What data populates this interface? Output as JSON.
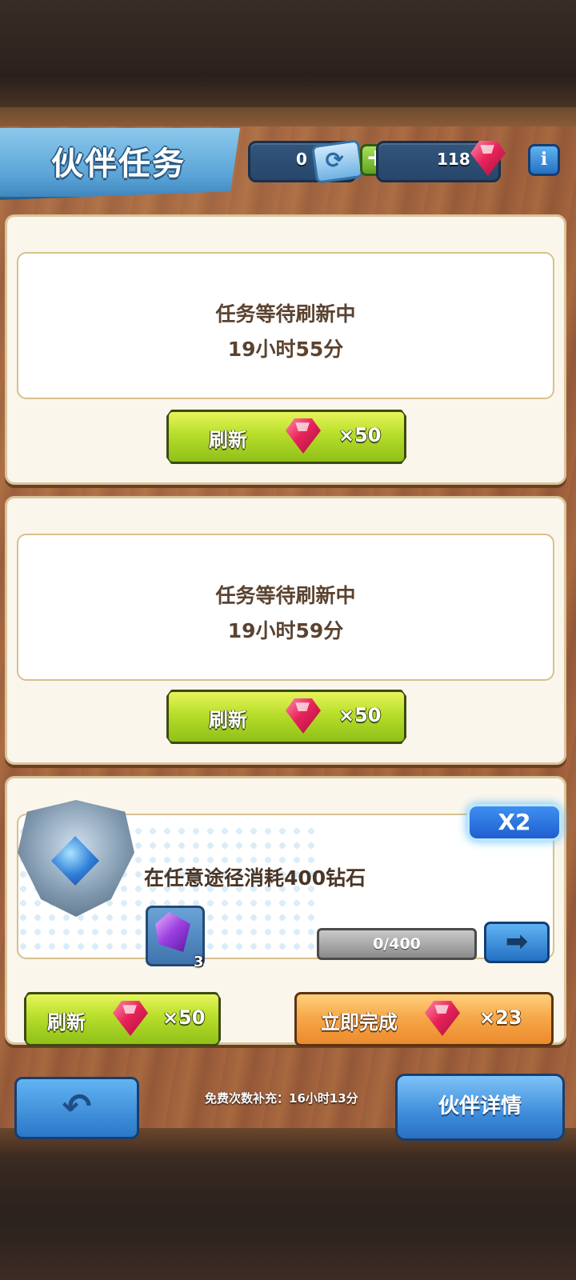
{
  "header": {
    "title": "伙伴任务",
    "ticket_count": "0",
    "gem_count": "118",
    "info_label": "i",
    "plus_label": "+"
  },
  "tasks": [
    {
      "status": "任务等待刷新中",
      "timer": "19小时55分",
      "refresh_label": "刷新",
      "refresh_cost": "×50"
    },
    {
      "status": "任务等待刷新中",
      "timer": "19小时59分",
      "refresh_label": "刷新",
      "refresh_cost": "×50"
    }
  ],
  "active_task": {
    "multiplier": "X2",
    "description": "在任意途径消耗400钻石",
    "reward_count": "3",
    "progress_text": "0/400",
    "progress": 0,
    "refresh_label": "刷新",
    "refresh_cost": "×50",
    "complete_label": "立即完成",
    "complete_cost": "×23",
    "arrow_icon": "➡"
  },
  "footer": {
    "back_icon": "↶",
    "free_refill": "免费次数补充：16小时13分",
    "detail_label": "伙伴详情"
  },
  "colors": {
    "green_button": "#b7de2a",
    "orange_button": "#f6a94a",
    "blue_button": "#3e8ddb",
    "gem": "#e8245a"
  }
}
